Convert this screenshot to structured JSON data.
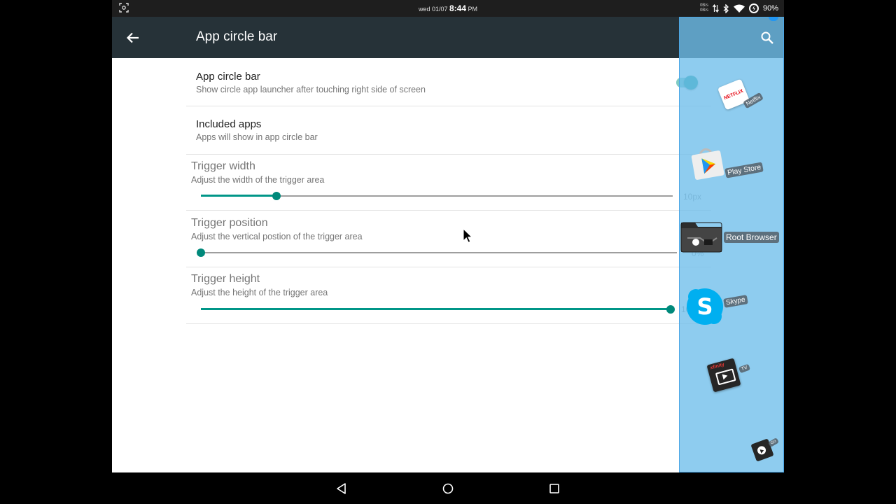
{
  "status_bar": {
    "day_date": "wed 01/07",
    "time": "8:44",
    "ampm": "PM",
    "net_up": "0B/s",
    "net_down": "0B/s",
    "battery": "90%"
  },
  "toolbar": {
    "back_icon": "arrow-back-icon",
    "title": "App circle bar",
    "search_icon": "search-icon"
  },
  "settings": {
    "app_circle_bar": {
      "title": "App circle bar",
      "subtitle": "Show circle app launcher after touching right side of screen",
      "enabled": true
    },
    "included_apps": {
      "title": "Included apps",
      "subtitle": "Apps will show in app circle bar"
    },
    "trigger_width": {
      "title": "Trigger width",
      "subtitle": "Adjust the width of the trigger area",
      "value_label": "10px",
      "fraction": 0.16
    },
    "trigger_position": {
      "title": "Trigger position",
      "subtitle": "Adjust the vertical postion of the trigger area",
      "value_label": "0%",
      "fraction": 0.0
    },
    "trigger_height": {
      "title": "Trigger height",
      "subtitle": "Adjust the height of the trigger area",
      "value_label": "10",
      "fraction": 1.0
    }
  },
  "circle_apps": [
    {
      "name": "Netflix",
      "logo_text": "NETFLIX"
    },
    {
      "name": "Play Store"
    },
    {
      "name": "Root Browser"
    },
    {
      "name": "Skype"
    },
    {
      "name": "TV",
      "logo_text": "xfinity"
    },
    {
      "name": "Go"
    }
  ],
  "colors": {
    "accent": "#009688",
    "toolbar": "#263238",
    "overlay": "#6ebeeb"
  },
  "nav": {
    "back_icon": "nav-back-icon",
    "home_icon": "nav-home-icon",
    "recents_icon": "nav-recents-icon"
  }
}
